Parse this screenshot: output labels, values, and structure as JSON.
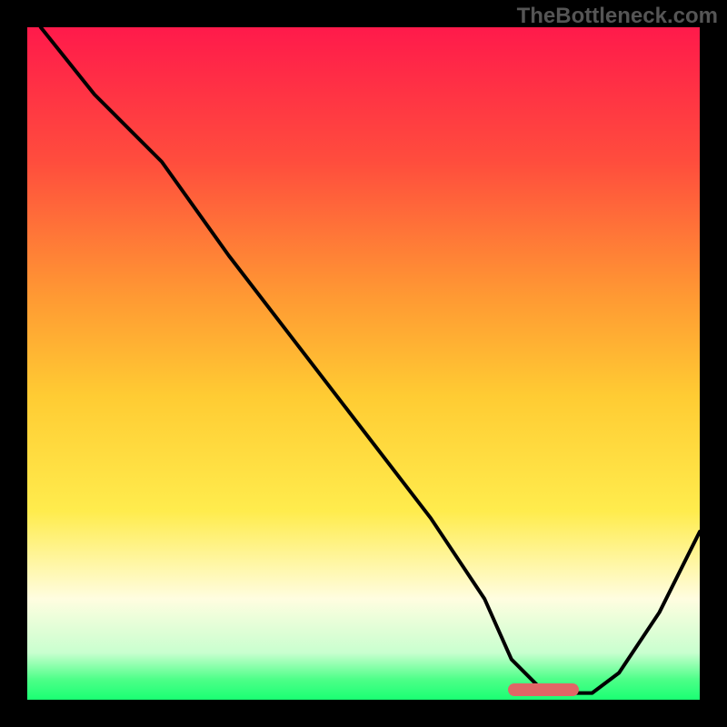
{
  "watermark": "TheBottleneck.com",
  "gradient_stops": [
    {
      "pct": 0,
      "color": "#ff1a4b"
    },
    {
      "pct": 20,
      "color": "#ff4d3d"
    },
    {
      "pct": 40,
      "color": "#ff9933"
    },
    {
      "pct": 55,
      "color": "#ffcc33"
    },
    {
      "pct": 72,
      "color": "#ffec4d"
    },
    {
      "pct": 85,
      "color": "#fffde0"
    },
    {
      "pct": 93,
      "color": "#c9ffcf"
    },
    {
      "pct": 97,
      "color": "#4dff88"
    },
    {
      "pct": 100,
      "color": "#1aff73"
    }
  ],
  "curve_color": "#000000",
  "curve_width": 4,
  "marker": {
    "x_start": 0.715,
    "x_end": 0.82,
    "y": 0.985,
    "color": "#e06666"
  },
  "chart_data": {
    "type": "line",
    "title": "",
    "xlabel": "",
    "ylabel": "",
    "xlim": [
      0,
      1
    ],
    "ylim": [
      0,
      1
    ],
    "x": [
      0.02,
      0.1,
      0.2,
      0.3,
      0.4,
      0.5,
      0.6,
      0.68,
      0.72,
      0.76,
      0.8,
      0.84,
      0.88,
      0.94,
      1.0
    ],
    "values": [
      1.0,
      0.9,
      0.8,
      0.66,
      0.53,
      0.4,
      0.27,
      0.15,
      0.06,
      0.02,
      0.01,
      0.01,
      0.04,
      0.13,
      0.25
    ],
    "optimum_range_x": [
      0.715,
      0.82
    ]
  }
}
